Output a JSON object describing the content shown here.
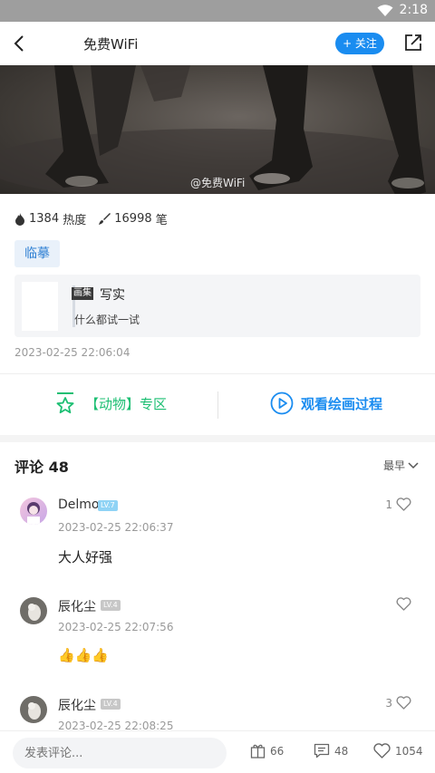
{
  "status_bar": {
    "time": "2:18"
  },
  "header": {
    "title": "免费WiFi",
    "follow_label": "+ 关注"
  },
  "hero": {
    "watermark": "@免费WiFi"
  },
  "stats": {
    "heat_value": "1384",
    "heat_label": "热度",
    "strokes_value": "16998",
    "strokes_label": "笔"
  },
  "tag": "临摹",
  "album": {
    "badge": "画集",
    "name": "写实",
    "description": "什么都试一试"
  },
  "post_date": "2023-02-25 22:06:04",
  "actions": {
    "zone": "【动物】专区",
    "watch": "观看绘画过程"
  },
  "comments_header": {
    "title": "评论 48",
    "sort": "最早"
  },
  "comments": [
    {
      "user": "Delmo",
      "level": "LV.7",
      "time": "2023-02-25 22:06:37",
      "text": "大人好强",
      "likes": "1"
    },
    {
      "user": "辰化尘",
      "level": "LV.4",
      "time": "2023-02-25 22:07:56",
      "text": "👍👍👍",
      "likes": ""
    },
    {
      "user": "辰化尘",
      "level": "LV.4",
      "time": "2023-02-25 22:08:25",
      "text": "",
      "likes": "3"
    }
  ],
  "bottom_bar": {
    "input_placeholder": "发表评论...",
    "gifts": "66",
    "comments": "48",
    "likes": "1054"
  },
  "colors": {
    "accent_blue": "#1a8cf0",
    "accent_green": "#1dbf73",
    "tag_bg": "#e9f1fa"
  }
}
